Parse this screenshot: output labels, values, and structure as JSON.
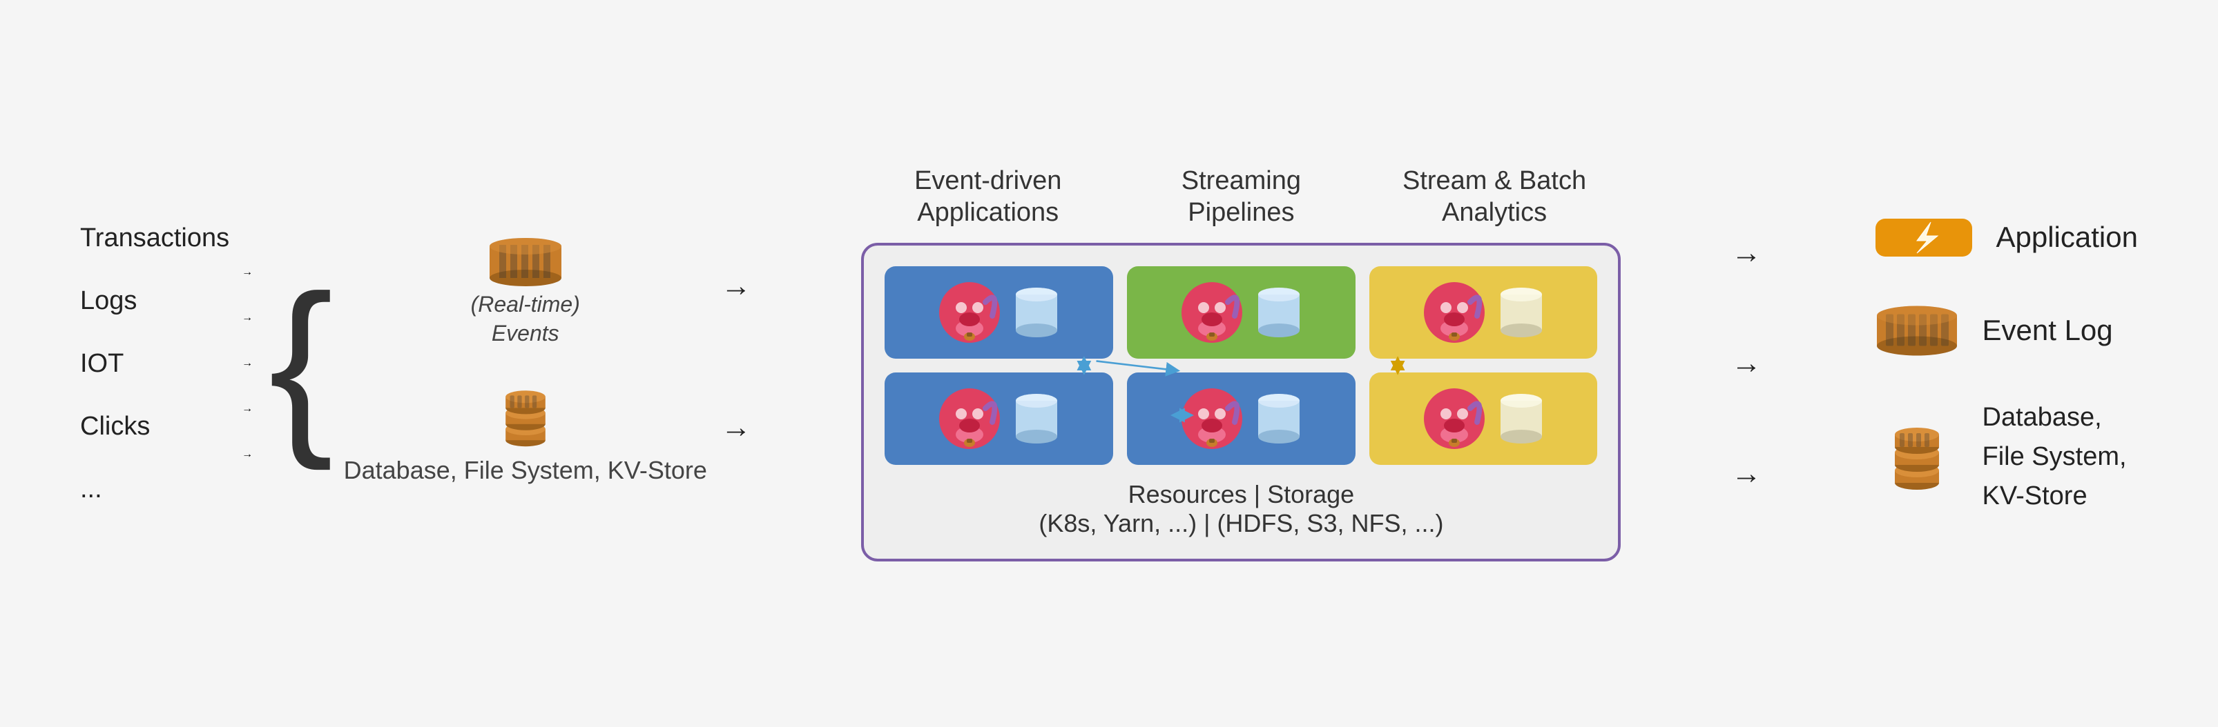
{
  "header": {
    "col1": "Event-driven\nApplications",
    "col2": "Streaming\nPipelines",
    "col3": "Stream & Batch\nAnalytics"
  },
  "inputs": {
    "labels": [
      "Transactions",
      "Logs",
      "IOT",
      "Clicks",
      "..."
    ],
    "events_label": "(Real-time)\nEvents",
    "db_label": "Database,\nFile System,\nKV-Store"
  },
  "main_box": {
    "resources_label": "Resources | Storage\n(K8s, Yarn, ...) | (HDFS, S3, NFS, ...)"
  },
  "outputs": {
    "app_label": "Application",
    "eventlog_label": "Event Log",
    "db_label": "Database,\nFile System,\nKV-Store"
  }
}
